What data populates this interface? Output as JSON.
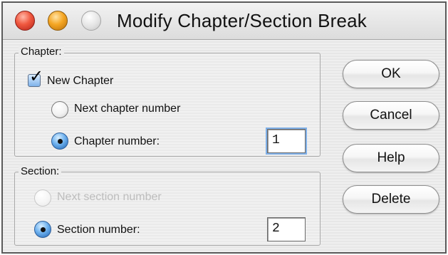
{
  "window": {
    "title": "Modify Chapter/Section Break"
  },
  "chapter": {
    "legend": "Chapter:",
    "new_chapter_label": "New Chapter",
    "new_chapter_checked": true,
    "next_number_label": "Next chapter number",
    "number_label": "Chapter number:",
    "number_value": "1"
  },
  "section": {
    "legend": "Section:",
    "next_number_label": "Next section number",
    "number_label": "Section number:",
    "number_value": "2"
  },
  "buttons": {
    "ok": "OK",
    "cancel": "Cancel",
    "help": "Help",
    "delete": "Delete"
  },
  "colors": {
    "accent": "#1f63b2",
    "window_border": "#5a5a5a",
    "disabled_text": "#bdbdbd"
  }
}
